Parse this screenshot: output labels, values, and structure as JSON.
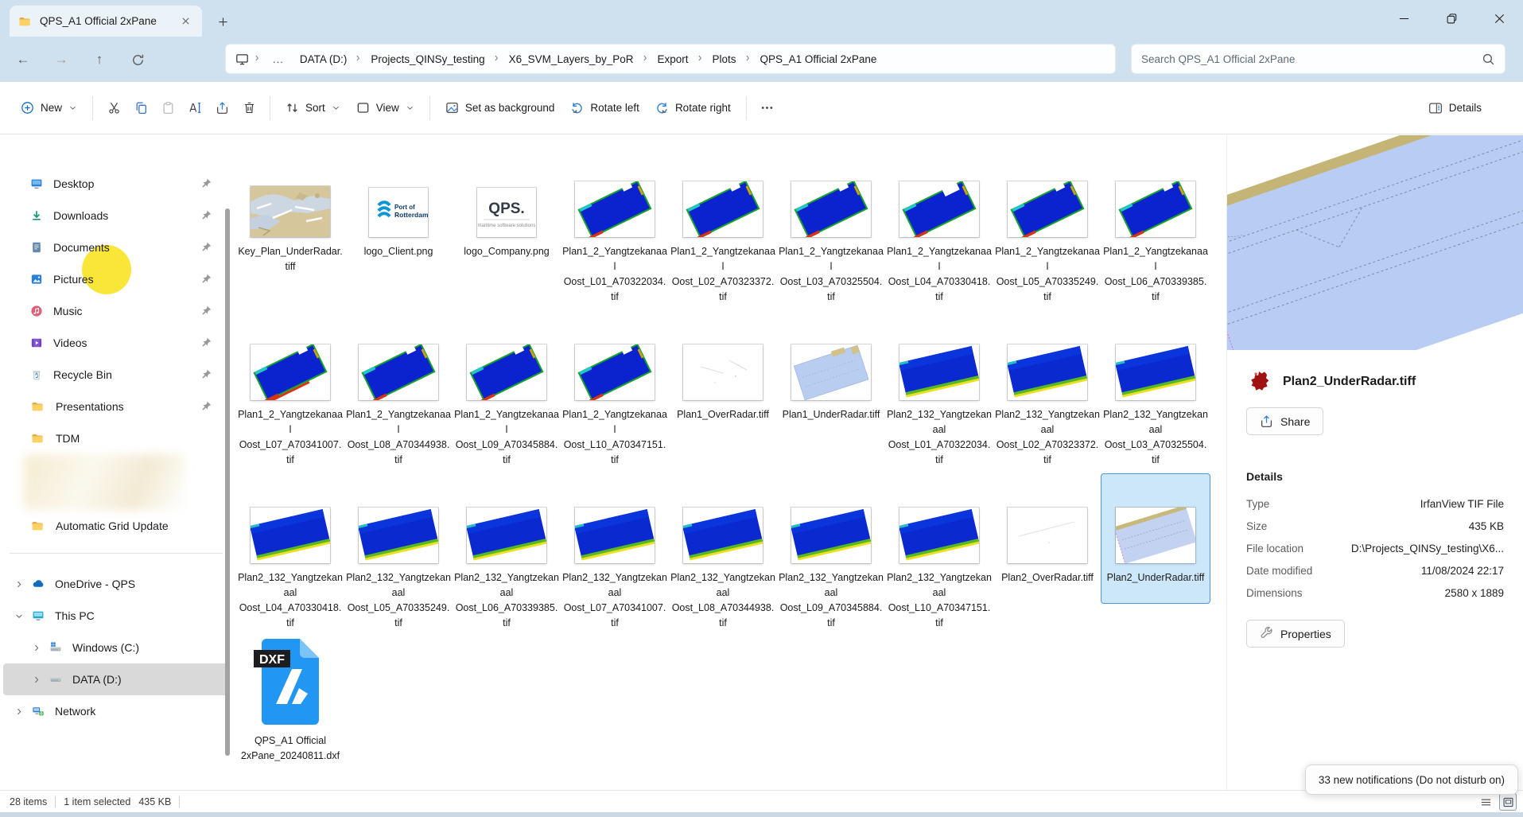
{
  "tab": {
    "title": "QPS_A1 Official 2xPane"
  },
  "breadcrumb": {
    "overflow": "...",
    "items": [
      "DATA (D:)",
      "Projects_QINSy_testing",
      "X6_SVM_Layers_by_PoR",
      "Export",
      "Plots",
      "QPS_A1 Official 2xPane"
    ]
  },
  "search": {
    "placeholder": "Search QPS_A1 Official 2xPane"
  },
  "toolbar": {
    "new_label": "New",
    "sort_label": "Sort",
    "view_label": "View",
    "set_as_background_label": "Set as background",
    "rotate_left_label": "Rotate left",
    "rotate_right_label": "Rotate right",
    "details_label": "Details"
  },
  "sidebar": {
    "quick_access": [
      {
        "label": "Desktop",
        "icon": "desktop",
        "pinned": true
      },
      {
        "label": "Downloads",
        "icon": "downloads",
        "pinned": true
      },
      {
        "label": "Documents",
        "icon": "documents",
        "pinned": true
      },
      {
        "label": "Pictures",
        "icon": "pictures",
        "pinned": true
      },
      {
        "label": "Music",
        "icon": "music",
        "pinned": true
      },
      {
        "label": "Videos",
        "icon": "videos",
        "pinned": true
      },
      {
        "label": "Recycle Bin",
        "icon": "recycle",
        "pinned": true
      },
      {
        "label": "Presentations",
        "icon": "folder",
        "pinned": true
      },
      {
        "label": "TDM",
        "icon": "folder",
        "pinned": false
      },
      {
        "label": "Automatic Grid Update",
        "icon": "folder",
        "pinned": false,
        "after_blur": true
      }
    ],
    "tree": [
      {
        "label": "OneDrive - QPS",
        "icon": "onedrive",
        "chevron": "right",
        "depth": 0,
        "selected": false
      },
      {
        "label": "This PC",
        "icon": "thispc",
        "chevron": "down",
        "depth": 0,
        "selected": false
      },
      {
        "label": "Windows (C:)",
        "icon": "drivewin",
        "chevron": "right",
        "depth": 1,
        "selected": false
      },
      {
        "label": "DATA (D:)",
        "icon": "drive",
        "chevron": "right",
        "depth": 1,
        "selected": true
      },
      {
        "label": "Network",
        "icon": "network",
        "chevron": "right",
        "depth": 0,
        "selected": false
      }
    ]
  },
  "files": {
    "items": [
      {
        "name": "Key_Plan_UnderRadar.tiff",
        "thumb": "map",
        "selected": false
      },
      {
        "name": "logo_Client.png",
        "thumb": "porlogo",
        "selected": false
      },
      {
        "name": "logo_Company.png",
        "thumb": "qpslogo",
        "selected": false
      },
      {
        "name": "Plan1_2_Yangtzekanaal Oost_L01_A70322034.tif",
        "thumb": "plan1",
        "selected": false
      },
      {
        "name": "Plan1_2_Yangtzekanaal Oost_L02_A70323372.tif",
        "thumb": "plan1",
        "selected": false
      },
      {
        "name": "Plan1_2_Yangtzekanaal Oost_L03_A70325504.tif",
        "thumb": "plan1",
        "selected": false
      },
      {
        "name": "Plan1_2_Yangtzekanaal Oost_L04_A70330418.tif",
        "thumb": "plan1n",
        "selected": false
      },
      {
        "name": "Plan1_2_Yangtzekanaal Oost_L05_A70335249.tif",
        "thumb": "plan1",
        "selected": false
      },
      {
        "name": "Plan1_2_Yangtzekanaal Oost_L06_A70339385.tif",
        "thumb": "plan1",
        "selected": false
      },
      {
        "name": "Plan1_2_Yangtzekanaal Oost_L07_A70341007.tif",
        "thumb": "plan1r",
        "selected": false
      },
      {
        "name": "Plan1_2_Yangtzekanaal Oost_L08_A70344938.tif",
        "thumb": "plan1",
        "selected": false
      },
      {
        "name": "Plan1_2_Yangtzekanaal Oost_L09_A70345884.tif",
        "thumb": "plan1",
        "selected": false
      },
      {
        "name": "Plan1_2_Yangtzekanaal Oost_L10_A70347151.tif",
        "thumb": "plan1",
        "selected": false
      },
      {
        "name": "Plan1_OverRadar.tiff",
        "thumb": "white",
        "selected": false
      },
      {
        "name": "Plan1_UnderRadar.tiff",
        "thumb": "light1",
        "selected": false
      },
      {
        "name": "Plan2_132_Yangtzekanaal Oost_L01_A70322034.tif",
        "thumb": "plan2",
        "selected": false
      },
      {
        "name": "Plan2_132_Yangtzekanaal Oost_L02_A70323372.tif",
        "thumb": "plan2",
        "selected": false
      },
      {
        "name": "Plan2_132_Yangtzekanaal Oost_L03_A70325504.tif",
        "thumb": "plan2",
        "selected": false
      },
      {
        "name": "Plan2_132_Yangtzekanaal Oost_L04_A70330418.tif",
        "thumb": "plan2",
        "selected": false
      },
      {
        "name": "Plan2_132_Yangtzekanaal Oost_L05_A70335249.tif",
        "thumb": "plan2",
        "selected": false
      },
      {
        "name": "Plan2_132_Yangtzekanaal Oost_L06_A70339385.tif",
        "thumb": "plan2",
        "selected": false
      },
      {
        "name": "Plan2_132_Yangtzekanaal Oost_L07_A70341007.tif",
        "thumb": "plan2",
        "selected": false
      },
      {
        "name": "Plan2_132_Yangtzekanaal Oost_L08_A70344938.tif",
        "thumb": "plan2",
        "selected": false
      },
      {
        "name": "Plan2_132_Yangtzekanaal Oost_L09_A70345884.tif",
        "thumb": "plan2",
        "selected": false
      },
      {
        "name": "Plan2_132_Yangtzekanaal Oost_L10_A70347151.tif",
        "thumb": "plan2",
        "selected": false
      },
      {
        "name": "Plan2_OverRadar.tiff",
        "thumb": "white2",
        "selected": false
      },
      {
        "name": "Plan2_UnderRadar.tiff",
        "thumb": "light2",
        "selected": true
      },
      {
        "name": "QPS_A1 Official 2xPane_20240811.dxf",
        "thumb": "dxf",
        "selected": false
      }
    ]
  },
  "details_pane": {
    "file_name": "Plan2_UnderRadar.tiff",
    "share_label": "Share",
    "details_heading": "Details",
    "rows": [
      {
        "label": "Type",
        "value": "IrfanView TIF File"
      },
      {
        "label": "Size",
        "value": "435 KB"
      },
      {
        "label": "File location",
        "value": "D:\\Projects_QINSy_testing\\X6..."
      },
      {
        "label": "Date modified",
        "value": "11/08/2024 22:17"
      },
      {
        "label": "Dimensions",
        "value": "2580 x 1889"
      }
    ],
    "properties_label": "Properties"
  },
  "statusbar": {
    "items_count": "28 items",
    "selection": "1 item selected",
    "selection_size": "435 KB"
  },
  "toast": {
    "text": "33 new notifications (Do not disturb on)"
  },
  "colors": {
    "titlebar_bg": "#cfe1ee",
    "accent": "#0f6cbd",
    "selection_bg": "#cde7fa",
    "selection_border": "#4a97dc",
    "sidebar_selected_bg": "#d9d9d9"
  }
}
